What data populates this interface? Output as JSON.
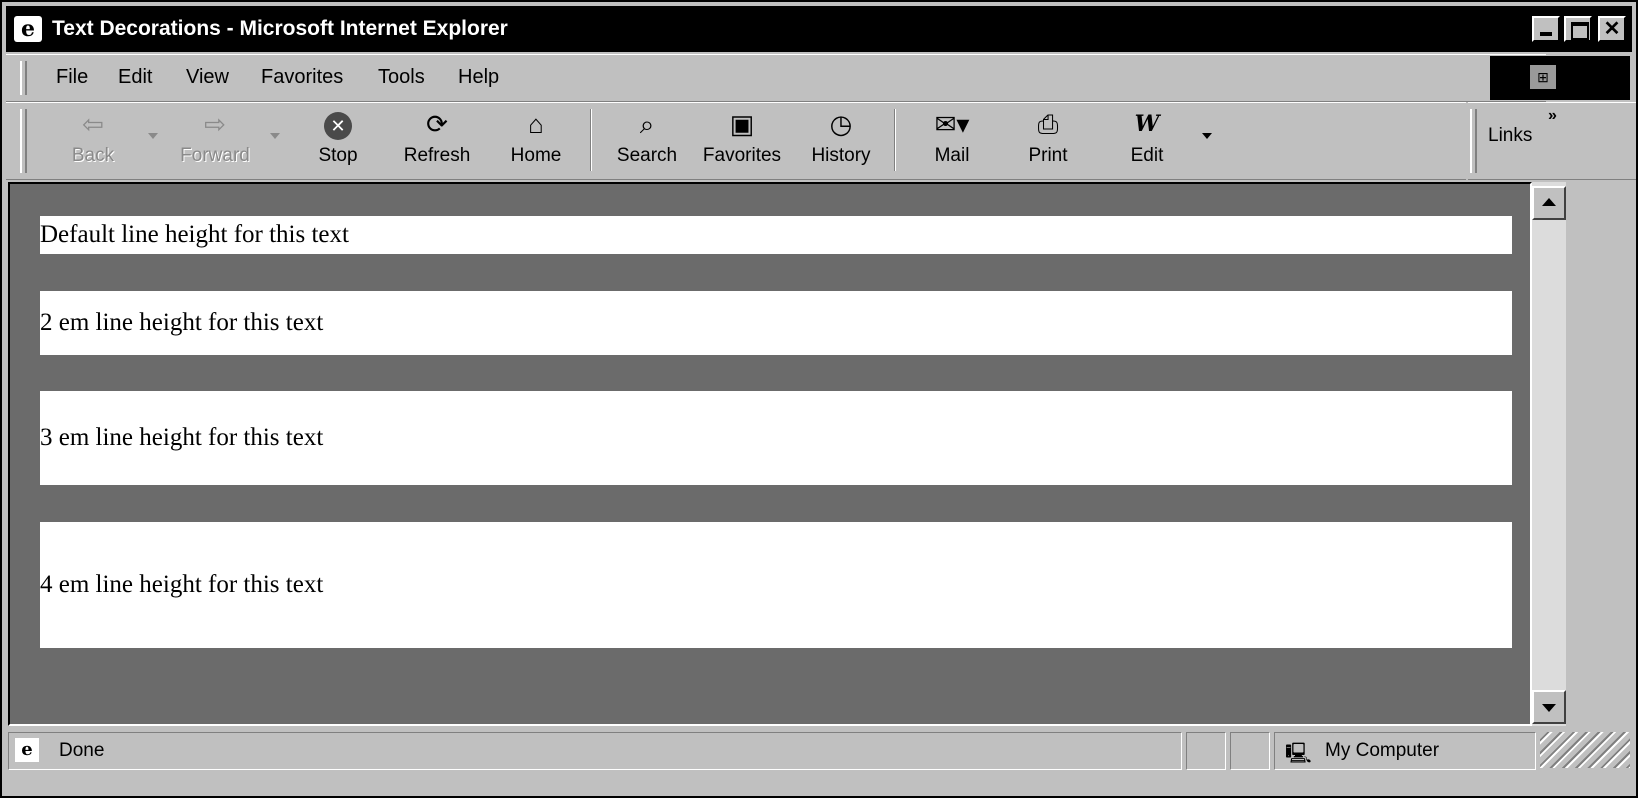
{
  "window": {
    "title": "Text Decorations - Microsoft Internet Explorer",
    "app_icon": "ie-page-icon"
  },
  "menu": {
    "items": [
      {
        "label": "File"
      },
      {
        "label": "Edit"
      },
      {
        "label": "View"
      },
      {
        "label": "Favorites"
      },
      {
        "label": "Tools"
      },
      {
        "label": "Help"
      }
    ]
  },
  "toolbar": {
    "back": {
      "label": "Back",
      "icon": "back-arrow-icon",
      "enabled": false
    },
    "forward": {
      "label": "Forward",
      "icon": "forward-arrow-icon",
      "enabled": false
    },
    "stop": {
      "label": "Stop",
      "icon": "stop-icon"
    },
    "refresh": {
      "label": "Refresh",
      "icon": "refresh-icon"
    },
    "home": {
      "label": "Home",
      "icon": "home-icon"
    },
    "search": {
      "label": "Search",
      "icon": "search-icon"
    },
    "favorites": {
      "label": "Favorites",
      "icon": "favorites-icon"
    },
    "history": {
      "label": "History",
      "icon": "history-icon"
    },
    "mail": {
      "label": "Mail",
      "icon": "mail-icon"
    },
    "print": {
      "label": "Print",
      "icon": "print-icon"
    },
    "edit": {
      "label": "Edit",
      "icon": "word-edit-icon"
    }
  },
  "links": {
    "label": "Links"
  },
  "content": {
    "lines": [
      {
        "text": "Default line height for this text"
      },
      {
        "text": "2 em line height for this text"
      },
      {
        "text": "3 em line height for this text"
      },
      {
        "text": "4 em line height for this text"
      }
    ],
    "background_color": "#6b6b6b",
    "box_color": "#ffffff"
  },
  "status": {
    "text": "Done",
    "zone": "My Computer"
  }
}
